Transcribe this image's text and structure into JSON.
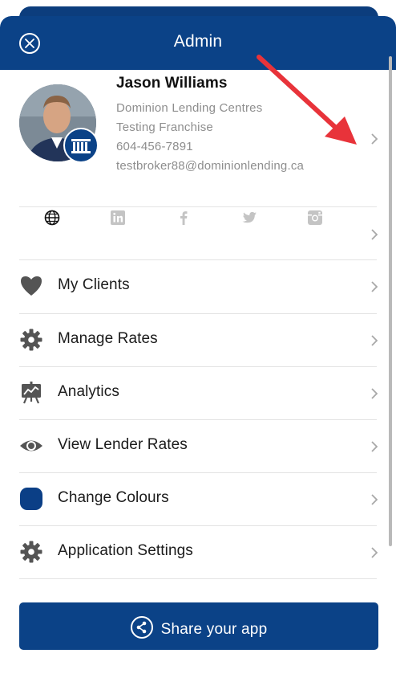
{
  "header": {
    "title": "Admin"
  },
  "profile": {
    "name": "Jason Williams",
    "company": "Dominion Lending Centres",
    "franchise": "Testing Franchise",
    "phone": "604-456-7891",
    "email": "testbroker88@dominionlending.ca"
  },
  "social": {
    "icons": [
      "globe-icon",
      "linkedin-icon",
      "facebook-icon",
      "twitter-icon",
      "instagram-icon"
    ]
  },
  "menu": [
    {
      "label": "My Clients",
      "icon": "heart-icon"
    },
    {
      "label": "Manage Rates",
      "icon": "gear-icon"
    },
    {
      "label": "Analytics",
      "icon": "presentation-chart-icon"
    },
    {
      "label": "View Lender Rates",
      "icon": "eye-icon"
    },
    {
      "label": "Change Colours",
      "icon": "color-swatch-icon"
    },
    {
      "label": "Application Settings",
      "icon": "gear-icon"
    }
  ],
  "share": {
    "label": "Share your app",
    "icon": "share-icon"
  },
  "colors": {
    "primary": "#0b4287",
    "swatch": "#0b3f86",
    "icon_gray": "#545454",
    "arrow": "#e8333a"
  }
}
